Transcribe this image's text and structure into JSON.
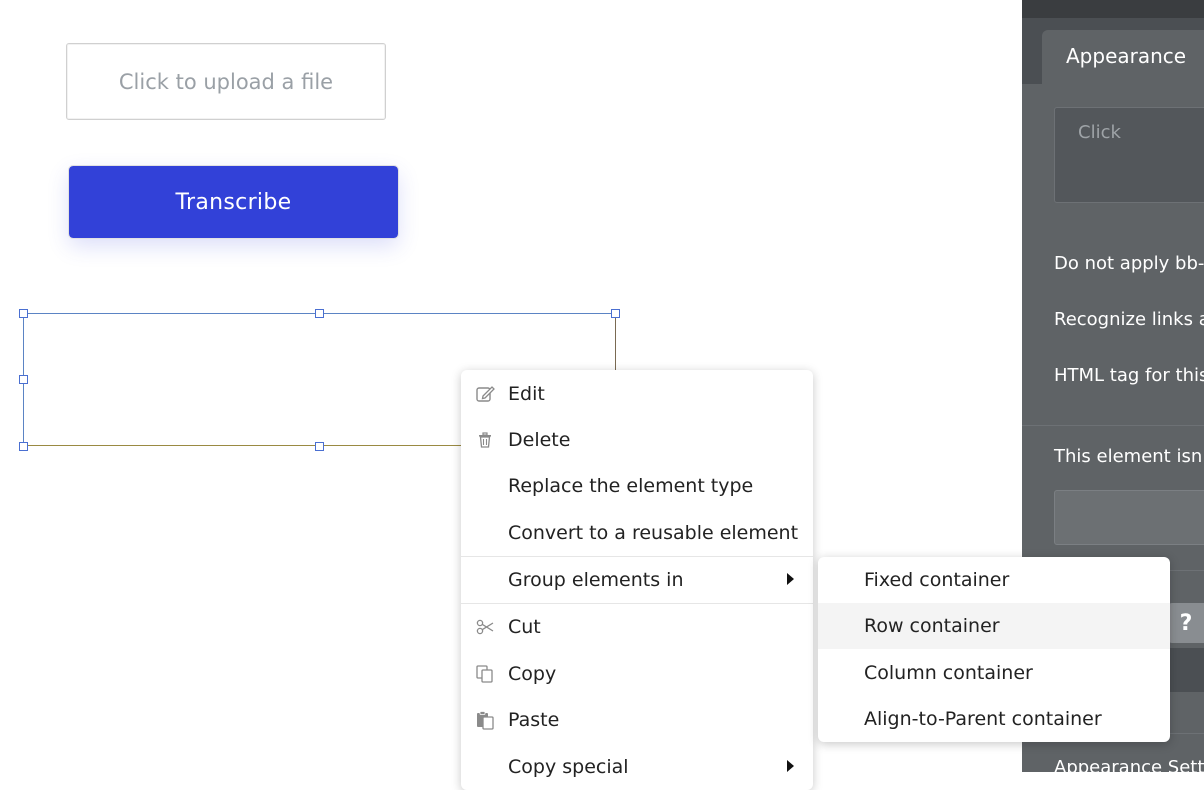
{
  "canvas": {
    "upload_placeholder": "Click to upload a file",
    "transcribe_label": "Transcribe"
  },
  "context_menu": {
    "items": [
      {
        "label": "Edit",
        "icon": "edit-icon"
      },
      {
        "label": "Delete",
        "icon": "trash-icon"
      },
      {
        "label": "Replace the element type",
        "icon": ""
      },
      {
        "label": "Convert to a reusable element",
        "icon": ""
      },
      {
        "label": "Group elements in",
        "icon": "",
        "submenu": true
      },
      {
        "label": "Cut",
        "icon": "scissors-icon"
      },
      {
        "label": "Copy",
        "icon": "copy-icon"
      },
      {
        "label": "Paste",
        "icon": "paste-icon"
      },
      {
        "label": "Copy special",
        "icon": "",
        "submenu": true
      }
    ]
  },
  "submenu": {
    "items": [
      {
        "label": "Fixed container"
      },
      {
        "label": "Row container",
        "highlighted": true
      },
      {
        "label": "Column container"
      },
      {
        "label": "Align-to-Parent container"
      }
    ]
  },
  "panel": {
    "tab_label": "Appearance",
    "input_placeholder": "Click",
    "rows": [
      "Do not apply bb-",
      "Recognize links a",
      "HTML tag for this",
      "This element isn'",
      "Appearance Setti"
    ],
    "help_label": "?"
  },
  "colors": {
    "primary_button": "#3241d8",
    "panel_bg": "#5f6366",
    "selection": "#4a6fd1"
  }
}
